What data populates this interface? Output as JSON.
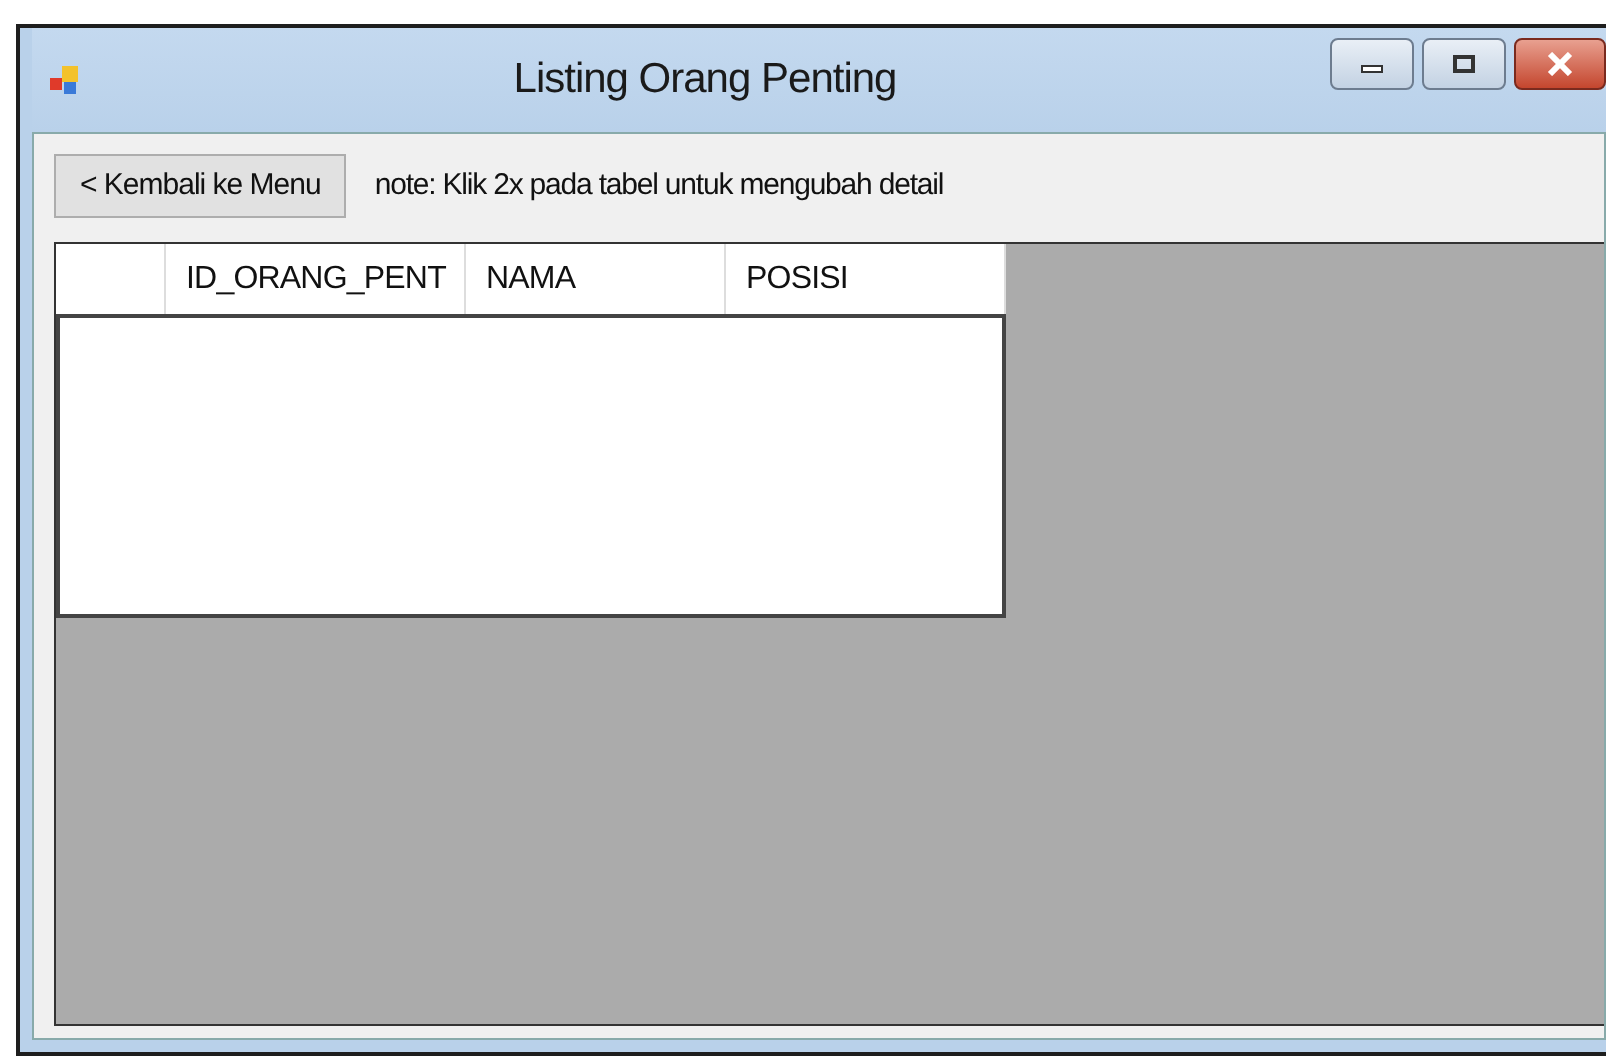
{
  "window": {
    "title": "Listing Orang Penting",
    "caption_buttons": [
      {
        "kind": "minimize"
      },
      {
        "kind": "maximize"
      },
      {
        "kind": "close"
      }
    ]
  },
  "back_button": {
    "label": "< Kembali ke Menu"
  },
  "note": "note: Klik 2x pada tabel untuk mengubah detail",
  "table": {
    "columns": [
      "ID_ORANG_PENT",
      "NAMA",
      "POSISI"
    ]
  }
}
